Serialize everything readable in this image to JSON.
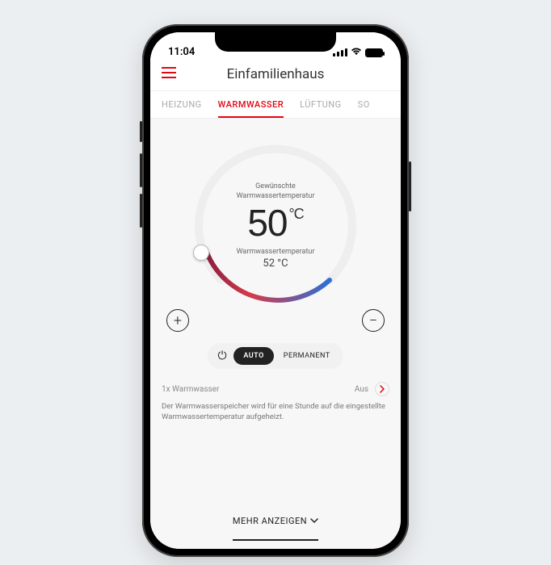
{
  "status_bar": {
    "time": "11:04"
  },
  "header": {
    "title": "Einfamilienhaus"
  },
  "tabs": {
    "items": [
      {
        "label": "HEIZUNG"
      },
      {
        "label": "WARMWASSER"
      },
      {
        "label": "LÜFTUNG"
      },
      {
        "label": "SO"
      }
    ],
    "active_index": 1
  },
  "dial": {
    "desired_label_line1": "Gewünschte",
    "desired_label_line2": "Warmwassertemperatur",
    "desired_value": "50",
    "desired_unit": "°C",
    "actual_label": "Warmwassertemperatur",
    "actual_value": "52 °C"
  },
  "controls": {
    "plus": "+",
    "minus": "−"
  },
  "modes": {
    "power_glyph": "⏻",
    "auto": "AUTO",
    "permanent": "PERMANENT",
    "active": "auto"
  },
  "info": {
    "left": "1x Warmwasser",
    "right": "Aus",
    "desc": "Der Warmwasserspeicher wird für eine Stunde auf die eingestellte Warmwassertemperatur aufgeheizt."
  },
  "footer": {
    "show_more": "MEHR ANZEIGEN"
  }
}
